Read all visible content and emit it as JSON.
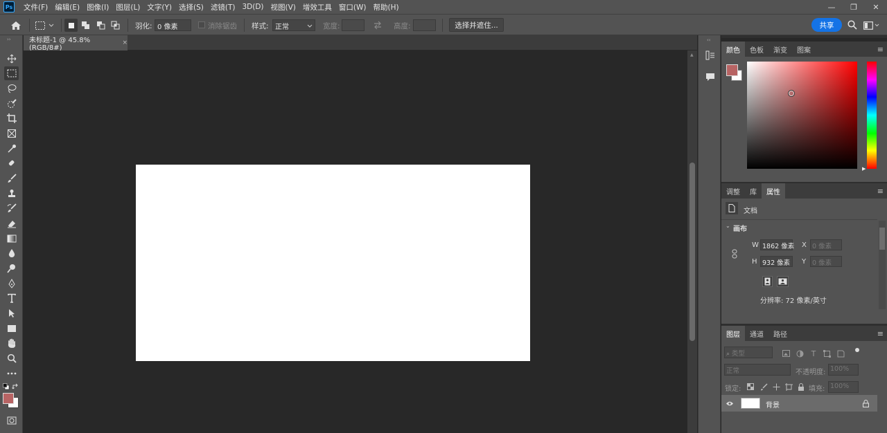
{
  "app": {
    "logo": "Ps"
  },
  "menu": [
    "文件(F)",
    "编辑(E)",
    "图像(I)",
    "图层(L)",
    "文字(Y)",
    "选择(S)",
    "滤镜(T)",
    "3D(D)",
    "视图(V)",
    "增效工具",
    "窗口(W)",
    "帮助(H)"
  ],
  "window_controls": {
    "minimize": "—",
    "restore": "❐",
    "close": "✕"
  },
  "options": {
    "feather_label": "羽化:",
    "feather_value": "0 像素",
    "antialias_label": "消除锯齿",
    "style_label": "样式:",
    "style_value": "正常",
    "width_label": "宽度:",
    "height_label": "高度:",
    "select_mask_label": "选择并遮住...",
    "share_label": "共享"
  },
  "document": {
    "tab_title": "未标题-1 @ 45.8%(RGB/8#)",
    "close": "×"
  },
  "color_panel": {
    "tabs": [
      "颜色",
      "色板",
      "渐变",
      "图案"
    ],
    "active_tab": 0,
    "foreground": "#b86464",
    "background": "#ffffff",
    "hue": "#ff0000"
  },
  "properties_panel": {
    "tabs": [
      "调整",
      "库",
      "属性"
    ],
    "active_tab": 2,
    "doc_label": "文档",
    "canvas_section": "画布",
    "w_label": "W",
    "w_value": "1862 像素",
    "h_label": "H",
    "h_value": "932 像素",
    "x_label": "X",
    "x_value": "0 像素",
    "y_label": "Y",
    "y_value": "0 像素",
    "resolution": "分辨率: 72 像素/英寸"
  },
  "layers_panel": {
    "tabs": [
      "图层",
      "通道",
      "路径"
    ],
    "active_tab": 0,
    "filter_kind": "类型",
    "blend_mode": "正常",
    "opacity_label": "不透明度:",
    "opacity_value": "100%",
    "lock_label": "锁定:",
    "fill_label": "填充:",
    "fill_value": "100%",
    "layers": [
      {
        "name": "背景",
        "visible": true,
        "locked": true
      }
    ]
  }
}
